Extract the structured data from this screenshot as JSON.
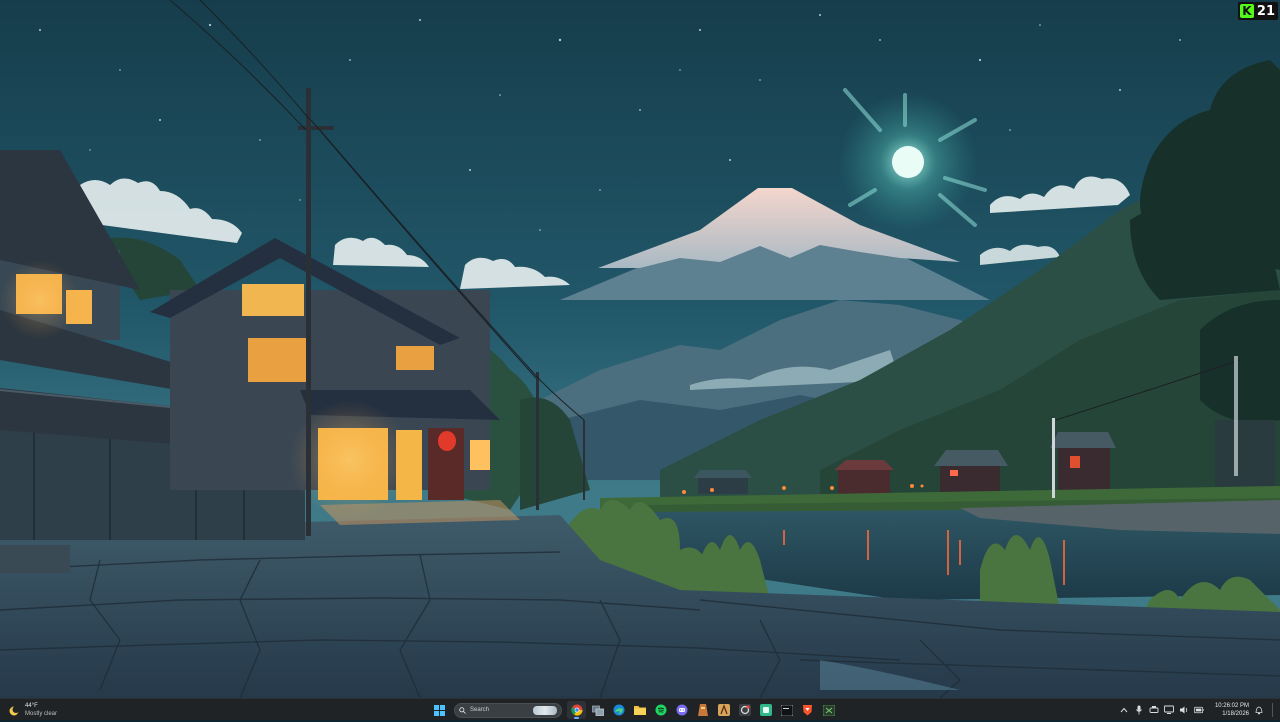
{
  "badge": {
    "count": "21",
    "logo_letter": "K"
  },
  "weather": {
    "temperature": "44°F",
    "condition": "Mostly clear"
  },
  "search": {
    "label": "Search"
  },
  "taskbar_apps": [
    {
      "name": "chrome-icon",
      "active": true
    },
    {
      "name": "task-view-icon",
      "active": false
    },
    {
      "name": "edge-icon",
      "active": false
    },
    {
      "name": "file-explorer-icon",
      "active": false
    },
    {
      "name": "spotify-icon",
      "active": false
    },
    {
      "name": "discord-icon",
      "active": false
    },
    {
      "name": "app-icon-1",
      "active": false
    },
    {
      "name": "app-icon-2",
      "active": false
    },
    {
      "name": "app-icon-3",
      "active": false
    },
    {
      "name": "app-icon-4",
      "active": false
    },
    {
      "name": "app-icon-5",
      "active": false
    },
    {
      "name": "brave-icon",
      "active": false
    },
    {
      "name": "xbox-icon",
      "active": false
    }
  ],
  "clock": {
    "time": "10:26:02 PM",
    "date": "1/18/2026"
  },
  "colors": {
    "taskbar": "#1f2326",
    "sky": "#1c4a59",
    "moon": "#e8f8f4",
    "lantern": "#d83a2a"
  }
}
